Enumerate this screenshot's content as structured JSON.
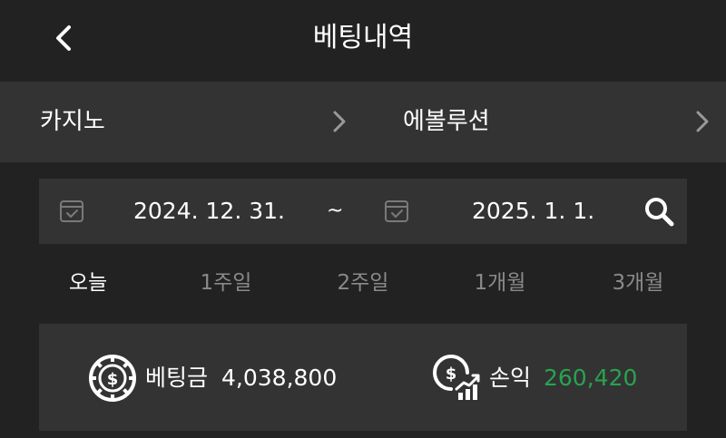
{
  "header": {
    "title": "베팅내역"
  },
  "selectors": {
    "category": "카지노",
    "provider": "에볼루션"
  },
  "date_range": {
    "start": "2024. 12. 31.",
    "separator": "~",
    "end": "2025. 1. 1."
  },
  "periods": [
    {
      "label": "오늘",
      "active": true
    },
    {
      "label": "1주일",
      "active": false
    },
    {
      "label": "2주일",
      "active": false
    },
    {
      "label": "1개월",
      "active": false
    },
    {
      "label": "3개월",
      "active": false
    }
  ],
  "summary": {
    "bet_label": "베팅금",
    "bet_value": "4,038,800",
    "profit_label": "손익",
    "profit_value": "260,420"
  },
  "colors": {
    "profit_positive": "#27a34f",
    "background": "#222222",
    "panel": "#333333",
    "inactive_text": "#8a8a8a"
  },
  "icons": [
    "back-chevron-icon",
    "chevron-right-icon",
    "calendar-icon",
    "search-icon",
    "casino-chip-icon",
    "dollar-growth-icon"
  ]
}
